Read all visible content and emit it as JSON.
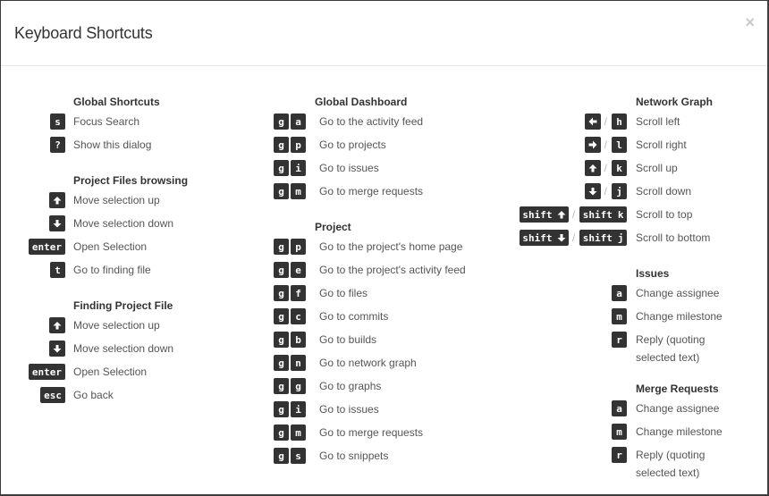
{
  "modal": {
    "title": "Keyboard Shortcuts",
    "close_label": "×"
  },
  "columns": [
    {
      "sections": [
        {
          "title": "Global Shortcuts",
          "items": [
            {
              "keys": [
                [
                  "s"
                ]
              ],
              "desc": "Focus Search"
            },
            {
              "keys": [
                [
                  "?"
                ]
              ],
              "desc": "Show this dialog"
            }
          ]
        },
        {
          "title": "Project Files browsing",
          "items": [
            {
              "keys": [
                [
                  "arrow-up"
                ]
              ],
              "desc": "Move selection up"
            },
            {
              "keys": [
                [
                  "arrow-down"
                ]
              ],
              "desc": "Move selection down"
            },
            {
              "keys": [
                [
                  "enter"
                ]
              ],
              "desc": "Open Selection"
            },
            {
              "keys": [
                [
                  "t"
                ]
              ],
              "desc": "Go to finding file"
            }
          ]
        },
        {
          "title": "Finding Project File",
          "items": [
            {
              "keys": [
                [
                  "arrow-up"
                ]
              ],
              "desc": "Move selection up"
            },
            {
              "keys": [
                [
                  "arrow-down"
                ]
              ],
              "desc": "Move selection down"
            },
            {
              "keys": [
                [
                  "enter"
                ]
              ],
              "desc": "Open Selection"
            },
            {
              "keys": [
                [
                  "esc"
                ]
              ],
              "desc": "Go back"
            }
          ]
        }
      ]
    },
    {
      "sections": [
        {
          "title": "Global Dashboard",
          "items": [
            {
              "keys": [
                [
                  "g",
                  "a"
                ]
              ],
              "desc": "Go to the activity feed"
            },
            {
              "keys": [
                [
                  "g",
                  "p"
                ]
              ],
              "desc": "Go to projects"
            },
            {
              "keys": [
                [
                  "g",
                  "i"
                ]
              ],
              "desc": "Go to issues"
            },
            {
              "keys": [
                [
                  "g",
                  "m"
                ]
              ],
              "desc": "Go to merge requests"
            }
          ]
        },
        {
          "title": "Project",
          "items": [
            {
              "keys": [
                [
                  "g",
                  "p"
                ]
              ],
              "desc": "Go to the project's home page"
            },
            {
              "keys": [
                [
                  "g",
                  "e"
                ]
              ],
              "desc": "Go to the project's activity feed"
            },
            {
              "keys": [
                [
                  "g",
                  "f"
                ]
              ],
              "desc": "Go to files"
            },
            {
              "keys": [
                [
                  "g",
                  "c"
                ]
              ],
              "desc": "Go to commits"
            },
            {
              "keys": [
                [
                  "g",
                  "b"
                ]
              ],
              "desc": "Go to builds"
            },
            {
              "keys": [
                [
                  "g",
                  "n"
                ]
              ],
              "desc": "Go to network graph"
            },
            {
              "keys": [
                [
                  "g",
                  "g"
                ]
              ],
              "desc": "Go to graphs"
            },
            {
              "keys": [
                [
                  "g",
                  "i"
                ]
              ],
              "desc": "Go to issues"
            },
            {
              "keys": [
                [
                  "g",
                  "m"
                ]
              ],
              "desc": "Go to merge requests"
            },
            {
              "keys": [
                [
                  "g",
                  "s"
                ]
              ],
              "desc": "Go to snippets"
            }
          ]
        }
      ]
    },
    {
      "sections": [
        {
          "title": "Network Graph",
          "items": [
            {
              "keys": [
                [
                  "arrow-left"
                ],
                [
                  "h"
                ]
              ],
              "desc": "Scroll left"
            },
            {
              "keys": [
                [
                  "arrow-right"
                ],
                [
                  "l"
                ]
              ],
              "desc": "Scroll right"
            },
            {
              "keys": [
                [
                  "arrow-up"
                ],
                [
                  "k"
                ]
              ],
              "desc": "Scroll up"
            },
            {
              "keys": [
                [
                  "arrow-down"
                ],
                [
                  "j"
                ]
              ],
              "desc": "Scroll down"
            },
            {
              "keys": [
                [
                  "shift arrow-up"
                ],
                [
                  "shift k"
                ]
              ],
              "desc": "Scroll to top"
            },
            {
              "keys": [
                [
                  "shift arrow-down"
                ],
                [
                  "shift j"
                ]
              ],
              "desc": "Scroll to bottom"
            }
          ]
        },
        {
          "title": "Issues",
          "items": [
            {
              "keys": [
                [
                  "a"
                ]
              ],
              "desc": "Change assignee"
            },
            {
              "keys": [
                [
                  "m"
                ]
              ],
              "desc": "Change milestone"
            },
            {
              "keys": [
                [
                  "r"
                ]
              ],
              "desc": "Reply (quoting selected text)",
              "wrap": true
            }
          ]
        },
        {
          "title": "Merge Requests",
          "items": [
            {
              "keys": [
                [
                  "a"
                ]
              ],
              "desc": "Change assignee"
            },
            {
              "keys": [
                [
                  "m"
                ]
              ],
              "desc": "Change milestone"
            },
            {
              "keys": [
                [
                  "r"
                ]
              ],
              "desc": "Reply (quoting selected text)",
              "wrap": true
            }
          ]
        }
      ]
    }
  ]
}
